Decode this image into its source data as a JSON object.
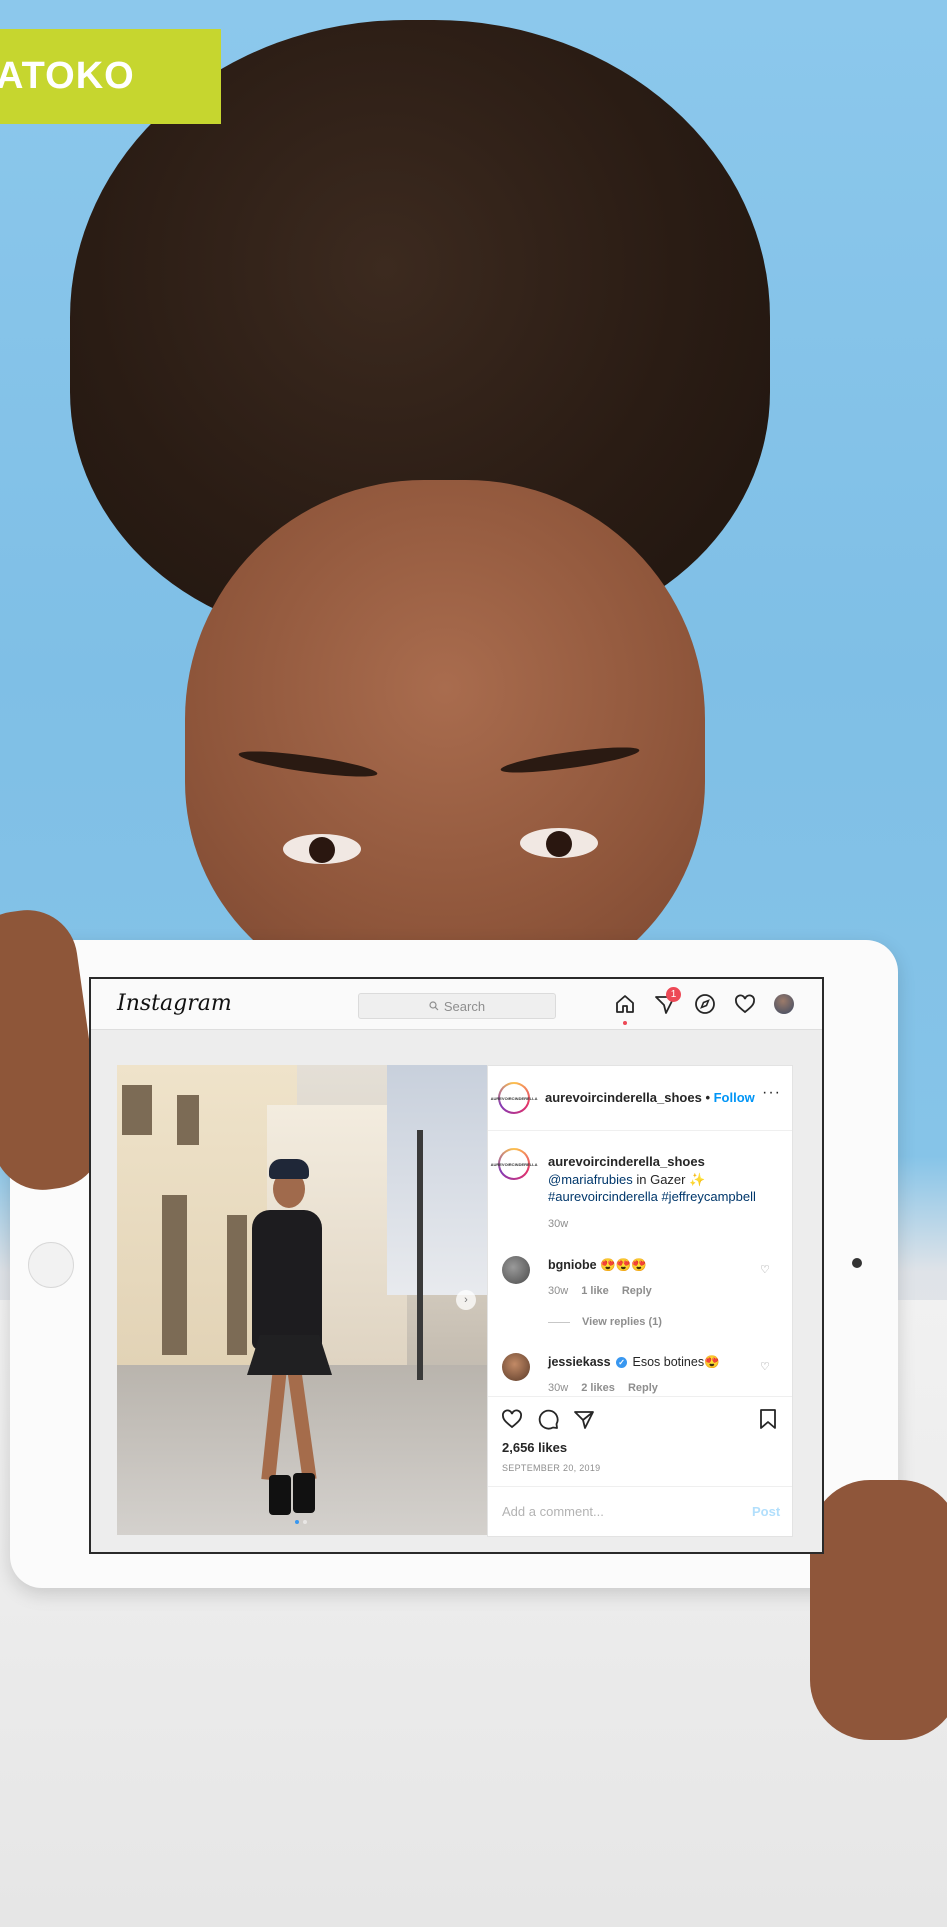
{
  "brand_tag": "ATOKO",
  "instagram": {
    "logo": "Instagram",
    "search_placeholder": "Search",
    "notification_count": "1",
    "nav_icons": [
      "home-icon",
      "activity-icon",
      "explore-icon",
      "heart-icon",
      "profile-avatar"
    ]
  },
  "post": {
    "account": "aurevoircinderella_shoes",
    "follow_label": "Follow",
    "more_label": "···",
    "avatar_text": "AUREVOIRCINDERELLA",
    "caption": {
      "username": "aurevoircinderella_shoes",
      "mention": "@mariafrubies",
      "text": " in Gazer ✨",
      "hashtags": "#aurevoircinderella #jeffreycampbell",
      "age": "30w"
    },
    "comments": [
      {
        "username": "bgniobe",
        "text": " 😍😍😍",
        "age": "30w",
        "likes": "1 like",
        "reply": "Reply",
        "view_replies": "View replies (1)"
      },
      {
        "username": "jessiekass",
        "verified_mark": "✓",
        "text": " Esos botines😍",
        "age": "30w",
        "likes": "2 likes",
        "reply": "Reply"
      }
    ],
    "likes": "2,656 likes",
    "date": "SEPTEMBER 20, 2019",
    "comment_placeholder": "Add a comment...",
    "post_button": "Post",
    "carousel_next": "›"
  },
  "colors": {
    "brand_tag_bg": "#c6d62f",
    "follow": "#0095f6",
    "badge": "#ed4956",
    "sky": "#8cc8ec"
  }
}
